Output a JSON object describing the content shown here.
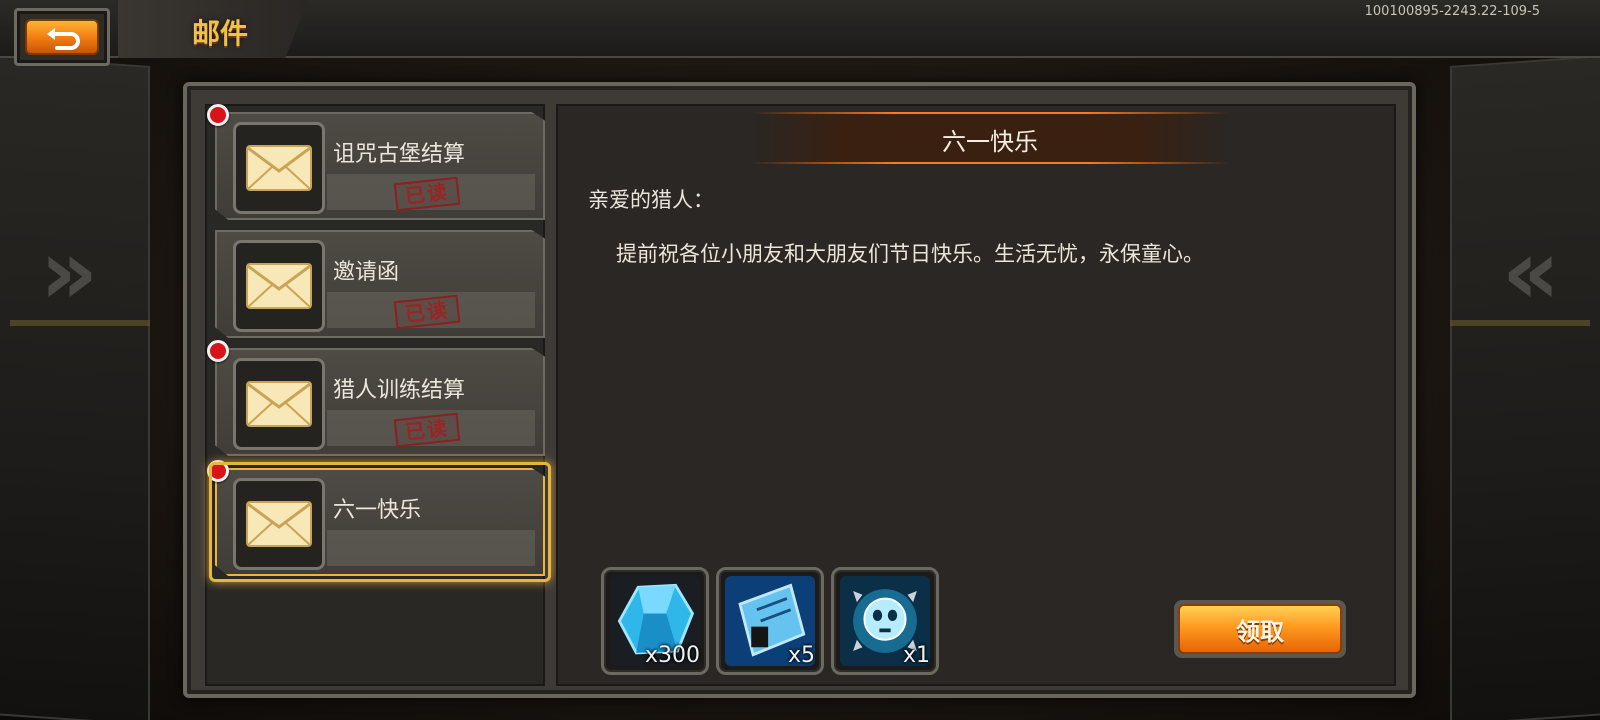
{
  "header": {
    "title": "邮件",
    "version": "100100895-2243.22-109-5"
  },
  "mail_list": [
    {
      "subject": "诅咒古堡结算",
      "read": true,
      "stamp": "已读",
      "unread_dot": true,
      "selected": false
    },
    {
      "subject": "邀请函",
      "read": true,
      "stamp": "已读",
      "unread_dot": false,
      "selected": false
    },
    {
      "subject": "猎人训练结算",
      "read": true,
      "stamp": "已读",
      "unread_dot": true,
      "selected": false
    },
    {
      "subject": "六一快乐",
      "read": false,
      "stamp": "",
      "unread_dot": true,
      "selected": true
    }
  ],
  "detail": {
    "title": "六一快乐",
    "greeting": "亲爱的猎人：",
    "body": "提前祝各位小朋友和大朋友们节日快乐。生活无忧，永保童心。",
    "rewards": [
      {
        "icon": "blue-crystal-icon",
        "count": "x300"
      },
      {
        "icon": "blueprint-scroll-icon",
        "count": "x5"
      },
      {
        "icon": "skull-emblem-icon",
        "count": "x1"
      }
    ],
    "claim_label": "领取"
  },
  "colors": {
    "accent": "#f1c24a",
    "button_orange": "#ff9a20",
    "unread_red": "#d8141a",
    "stamp_red": "#9a2424"
  }
}
